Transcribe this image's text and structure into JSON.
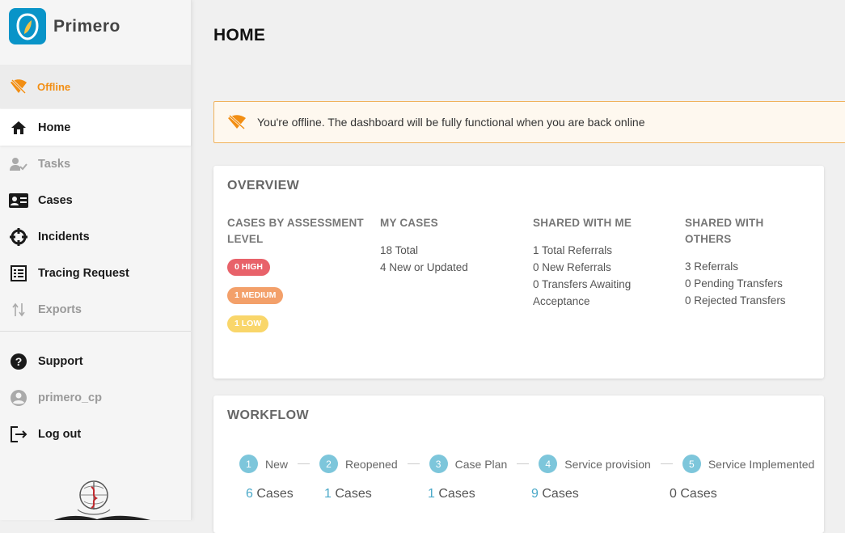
{
  "app": {
    "name": "Primero"
  },
  "sidebar": {
    "offline_label": "Offline",
    "items": [
      {
        "label": "Home",
        "icon": "home-icon"
      },
      {
        "label": "Tasks",
        "icon": "tasks-icon"
      },
      {
        "label": "Cases",
        "icon": "cases-icon"
      },
      {
        "label": "Incidents",
        "icon": "incidents-icon"
      },
      {
        "label": "Tracing Request",
        "icon": "tracing-request-icon"
      },
      {
        "label": "Exports",
        "icon": "exports-icon"
      }
    ],
    "secondary": [
      {
        "label": "Support",
        "icon": "help-icon"
      },
      {
        "label": "primero_cp",
        "icon": "user-icon"
      },
      {
        "label": "Log out",
        "icon": "logout-icon"
      }
    ]
  },
  "main": {
    "title": "HOME",
    "offline_banner": "You're offline. The dashboard will be fully functional when you are back online",
    "overview": {
      "title": "OVERVIEW",
      "assessment": {
        "header": "CASES BY ASSESSMENT LEVEL",
        "high": "0 HIGH",
        "medium": "1 MEDIUM",
        "low": "1 LOW"
      },
      "my_cases": {
        "header": "MY CASES",
        "total": "18 Total",
        "new": "4 New or Updated"
      },
      "shared_with_me": {
        "header": "SHARED WITH ME",
        "referrals": "1 Total Referrals",
        "new_referrals": "0 New Referrals",
        "transfers": "0 Transfers Awaiting Acceptance"
      },
      "shared_with_others": {
        "header": "SHARED WITH OTHERS",
        "referrals": "3 Referrals",
        "pending": "0 Pending Transfers",
        "rejected": "0 Rejected Transfers"
      }
    },
    "workflow": {
      "title": "WORKFLOW",
      "steps": [
        {
          "num": "1",
          "name": "New",
          "count": "6",
          "unit": "Cases"
        },
        {
          "num": "2",
          "name": "Reopened",
          "count": "1",
          "unit": "Cases"
        },
        {
          "num": "3",
          "name": "Case Plan",
          "count": "1",
          "unit": "Cases"
        },
        {
          "num": "4",
          "name": "Service provision",
          "count": "9",
          "unit": "Cases"
        },
        {
          "num": "5",
          "name": "Service Implemented",
          "count": "0",
          "unit": "Cases"
        }
      ]
    }
  },
  "colors": {
    "brand": "#0994c8",
    "offline": "#f28e13",
    "high": "#e8626a",
    "medium": "#f3a06a",
    "low": "#f9d66a",
    "step": "#7dc6db"
  }
}
